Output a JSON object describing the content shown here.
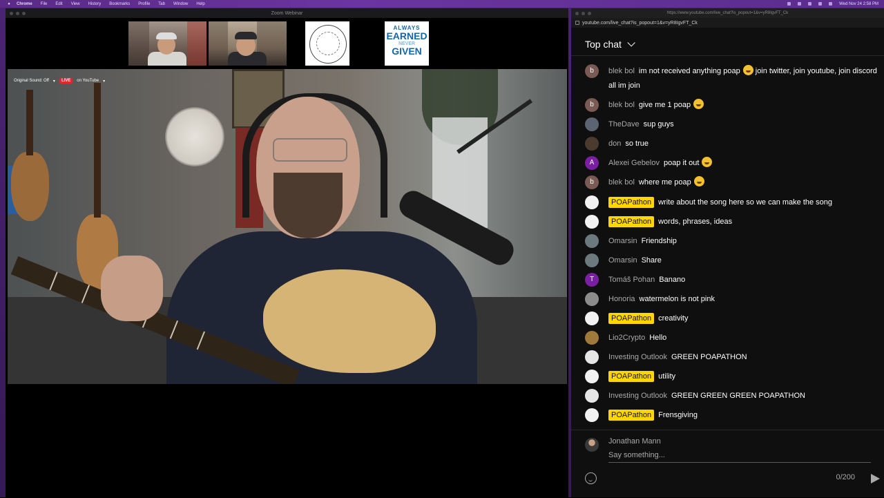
{
  "menubar": {
    "items": [
      "Chrome",
      "File",
      "Edit",
      "View",
      "History",
      "Bookmarks",
      "Profile",
      "Tab",
      "Window",
      "Help"
    ],
    "clock": "Wed Nov 24  2:58 PM"
  },
  "zoom": {
    "window_title": "Zoom Webinar",
    "original_sound": "Original Sound: Off",
    "live_badge": "LIVE",
    "live_destination": "on YouTube",
    "thumbnail_logo": {
      "line1": "ALWAYS",
      "line2": "EARNED",
      "line3": "NEVER",
      "line4": "GIVEN"
    }
  },
  "chat_window": {
    "title_url": "https://www.youtube.com/live_chat?is_popout=1&v=yR8IgvFT_Ck",
    "address": "youtube.com/live_chat?is_popout=1&v=yR8IgvFT_Ck",
    "header_title": "Top chat",
    "messages": [
      {
        "author": "blek bol",
        "text": "im not received anything poap",
        "text2": "join twitter, join youtube, join discord all im join",
        "avatar_letter": "b",
        "avatar_color": "#7a5a54",
        "owner": false
      },
      {
        "author": "blek bol",
        "text": "give me 1 poap",
        "avatar_letter": "b",
        "avatar_color": "#7a5a54",
        "owner": false
      },
      {
        "author": "TheDave",
        "text": "sup guys",
        "avatar_letter": "",
        "avatar_color": "#5b6470",
        "owner": false
      },
      {
        "author": "don",
        "text": "so true",
        "avatar_letter": "",
        "avatar_color": "#4b3b2f",
        "owner": false
      },
      {
        "author": "Alexei Gebelov",
        "text": "poap it out",
        "avatar_letter": "A",
        "avatar_color": "#7b1fa2",
        "owner": false
      },
      {
        "author": "blek bol",
        "text": "where me poap",
        "avatar_letter": "b",
        "avatar_color": "#7a5a54",
        "owner": false
      },
      {
        "author": "POAPathon",
        "text": "write about the song here so we can make the song",
        "avatar_letter": "",
        "avatar_color": "#f2f2f2",
        "owner": true
      },
      {
        "author": "POAPathon",
        "text": "words, phrases, ideas",
        "avatar_letter": "",
        "avatar_color": "#f2f2f2",
        "owner": true
      },
      {
        "author": "Omarsin",
        "text": "Friendship",
        "avatar_letter": "",
        "avatar_color": "#6c7a80",
        "owner": false
      },
      {
        "author": "Omarsin",
        "text": "Share",
        "avatar_letter": "",
        "avatar_color": "#6c7a80",
        "owner": false
      },
      {
        "author": "Tomáš Pohan",
        "text": "Banano",
        "avatar_letter": "T",
        "avatar_color": "#7b1fa2",
        "owner": false
      },
      {
        "author": "Honoria",
        "text": "watermelon is not pink",
        "avatar_letter": "",
        "avatar_color": "#8c8c8c",
        "owner": false
      },
      {
        "author": "POAPathon",
        "text": "creativity",
        "avatar_letter": "",
        "avatar_color": "#f2f2f2",
        "owner": true
      },
      {
        "author": "Lio2Crypto",
        "text": "Hello",
        "avatar_letter": "",
        "avatar_color": "#a07a3a",
        "owner": false
      },
      {
        "author": "Investing Outlook",
        "text": "GREEN POAPATHON",
        "avatar_letter": "",
        "avatar_color": "#e6e6e6",
        "owner": false
      },
      {
        "author": "POAPathon",
        "text": "utility",
        "avatar_letter": "",
        "avatar_color": "#f2f2f2",
        "owner": true
      },
      {
        "author": "Investing Outlook",
        "text": "GREEN GREEN GREEN POAPATHON",
        "avatar_letter": "",
        "avatar_color": "#e6e6e6",
        "owner": false
      },
      {
        "author": "POAPathon",
        "text": "Frensgiving",
        "avatar_letter": "",
        "avatar_color": "#f2f2f2",
        "owner": true
      }
    ],
    "input": {
      "user_name": "Jonathan Mann",
      "placeholder": "Say something...",
      "char_count": "0/200"
    },
    "colors": {
      "owner_badge": "#ffd600",
      "live_red": "#e0292c"
    }
  }
}
